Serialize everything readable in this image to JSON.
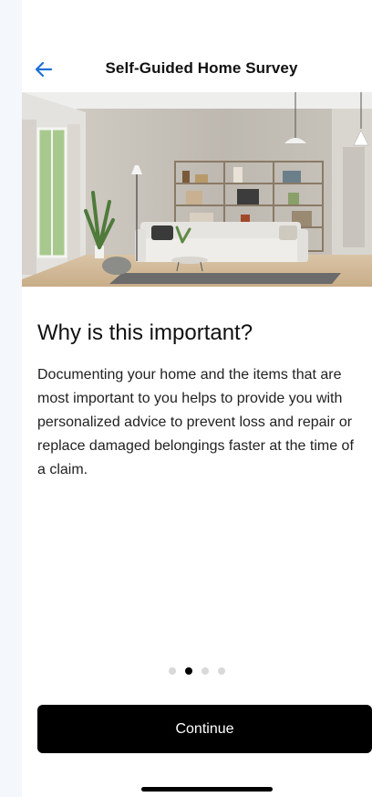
{
  "header": {
    "title": "Self-Guided Home Survey",
    "back_icon": "arrow-left-icon",
    "accent_color": "#1f6fd6"
  },
  "hero": {
    "description_icon": "living-room-photo"
  },
  "content": {
    "heading": "Why is this important?",
    "body": "Documenting your home and the items that are most important to you helps to provide you with personalized advice to prevent loss and repair or replace damaged belongings faster at the time of a claim."
  },
  "pagination": {
    "total": 4,
    "current": 2
  },
  "actions": {
    "continue_label": "Continue"
  }
}
